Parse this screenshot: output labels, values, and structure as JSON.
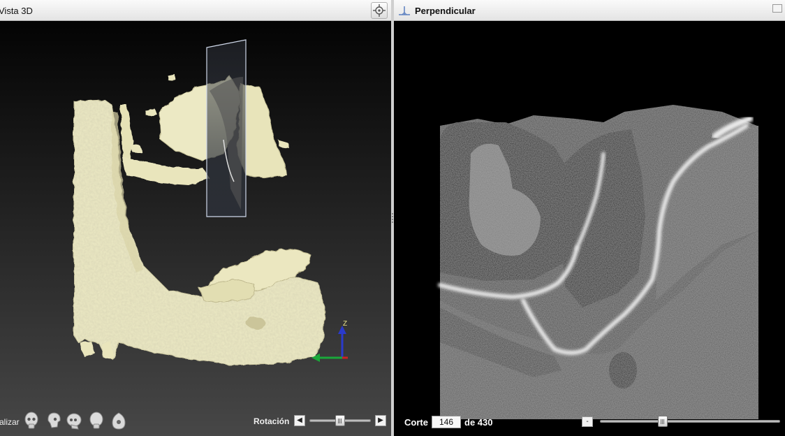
{
  "left_panel": {
    "title": "Vista 3D",
    "visualize_label": "alizar",
    "presets": [
      "skull-front-icon",
      "skull-side-icon",
      "skull-oblique-icon",
      "skull-back-icon",
      "skull-bottom-icon"
    ],
    "rotation_label": "Rotación",
    "rotation_slider_value": 0.5,
    "axis_labels": {
      "z": "Z"
    }
  },
  "right_panel": {
    "title": "Perpendicular",
    "slice_label": "Corte",
    "slice_value": "146",
    "slice_total": "de 430",
    "zoom_out_label": "-",
    "slice_slider_value": 0.35
  },
  "colors": {
    "bone": "#ece9c4",
    "axis_z": "#2a3acb",
    "axis_y": "#1aa83a",
    "axis_x": "#c22"
  }
}
